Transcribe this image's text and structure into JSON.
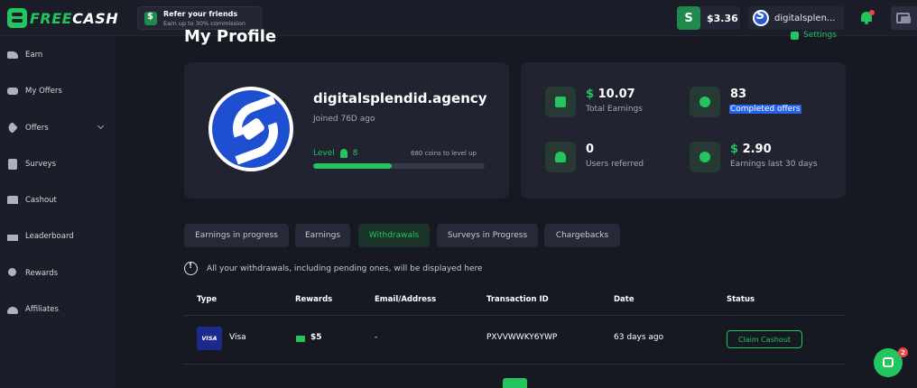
{
  "app": {
    "logo_free": "FREE",
    "logo_cash": "CASH",
    "brand_color": "#22c55e"
  },
  "header": {
    "refer_title": "Refer your friends",
    "refer_subtitle": "Earn up to 30% commission",
    "balance": "$3.36",
    "username": "digitalsplen..."
  },
  "sidebar": {
    "items": [
      {
        "label": "Earn",
        "icon": "earn-icon"
      },
      {
        "label": "My Offers",
        "icon": "gamepad-icon"
      },
      {
        "label": "Offers",
        "icon": "tag-icon",
        "has_chevron": true
      },
      {
        "label": "Surveys",
        "icon": "clipboard-icon"
      },
      {
        "label": "Cashout",
        "icon": "store-icon"
      },
      {
        "label": "Leaderboard",
        "icon": "podium-icon"
      },
      {
        "label": "Rewards",
        "icon": "medal-icon"
      },
      {
        "label": "Affiliates",
        "icon": "users-icon"
      }
    ]
  },
  "page": {
    "title": "My Profile",
    "settings_label": "Settings"
  },
  "profile": {
    "name": "digitalsplendid.agency",
    "joined": "Joined 76D ago",
    "level_label": "Level",
    "level": "8",
    "coins_to_level": "680 coins to level up",
    "level_progress": 0.46
  },
  "stats": [
    {
      "currency": "$",
      "value": "10.07",
      "label": "Total Earnings",
      "icon": "wallet-icon"
    },
    {
      "currency": "",
      "value": "83",
      "label": "Completed offers",
      "icon": "check-badge-icon",
      "highlighted": true
    },
    {
      "currency": "",
      "value": "0",
      "label": "Users referred",
      "icon": "users-icon"
    },
    {
      "currency": "$",
      "value": "2.90",
      "label": "Earnings last 30 days",
      "icon": "clock-icon"
    }
  ],
  "tabs": [
    {
      "label": "Earnings in progress",
      "active": false
    },
    {
      "label": "Earnings",
      "active": false
    },
    {
      "label": "Withdrawals",
      "active": true
    },
    {
      "label": "Surveys in Progress",
      "active": false
    },
    {
      "label": "Chargebacks",
      "active": false
    }
  ],
  "info_text": "All your withdrawals, including pending ones, will be displayed here",
  "table": {
    "headers": [
      "Type",
      "Rewards",
      "Email/Address",
      "Transaction ID",
      "Date",
      "Status"
    ],
    "rows": [
      {
        "type_badge": "VISA",
        "type": "Visa",
        "reward": "$5",
        "address": "-",
        "transaction_id": "PXVVWWKY6YWP",
        "date": "63 days ago",
        "status": "Claim Cashout"
      }
    ]
  },
  "chat": {
    "badge": "2"
  }
}
